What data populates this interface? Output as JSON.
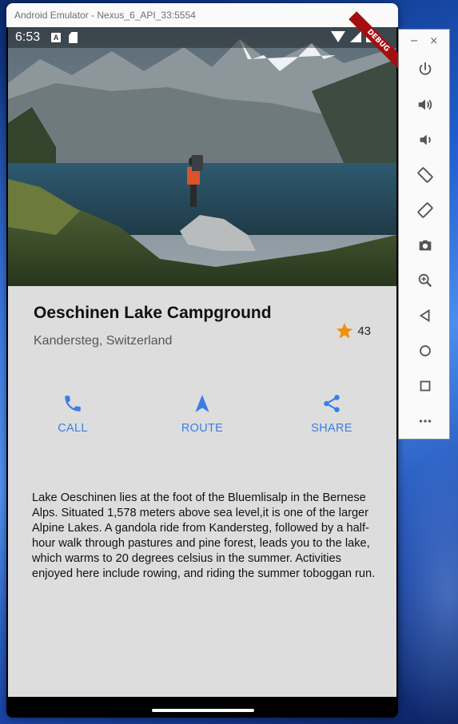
{
  "window": {
    "title": "Android Emulator - Nexus_6_API_33:5554"
  },
  "status_bar": {
    "time": "6:53",
    "debug_label": "DEBUG"
  },
  "place": {
    "title": "Oeschinen Lake Campground",
    "subtitle": "Kandersteg, Switzerland",
    "rating_count": "43"
  },
  "actions": [
    {
      "label": "CALL",
      "icon": "phone-icon"
    },
    {
      "label": "ROUTE",
      "icon": "navigation-icon"
    },
    {
      "label": "SHARE",
      "icon": "share-icon"
    }
  ],
  "description": "Lake Oeschinen lies at the foot of the Bluemlisalp in the Bernese Alps. Situated 1,578 meters above sea level,it is one of the larger Alpine Lakes. A gandola ride from Kandersteg, followed by a half-hour walk through pastures and pine forest, leads you to the lake, which warms to 20 degrees celsius in the summer. Activities enjoyed here include rowing, and riding the summer toboggan run.",
  "toolbar": {
    "minimize": "−",
    "close": "×",
    "items": [
      "power-icon",
      "volume-up-icon",
      "volume-down-icon",
      "rotate-left-icon",
      "rotate-right-icon",
      "camera-icon",
      "zoom-icon",
      "back-icon",
      "home-icon",
      "overview-icon",
      "more-icon"
    ]
  },
  "colors": {
    "accent": "#3a7ee4",
    "star": "#f0900a",
    "content_bg": "#dddddd"
  }
}
